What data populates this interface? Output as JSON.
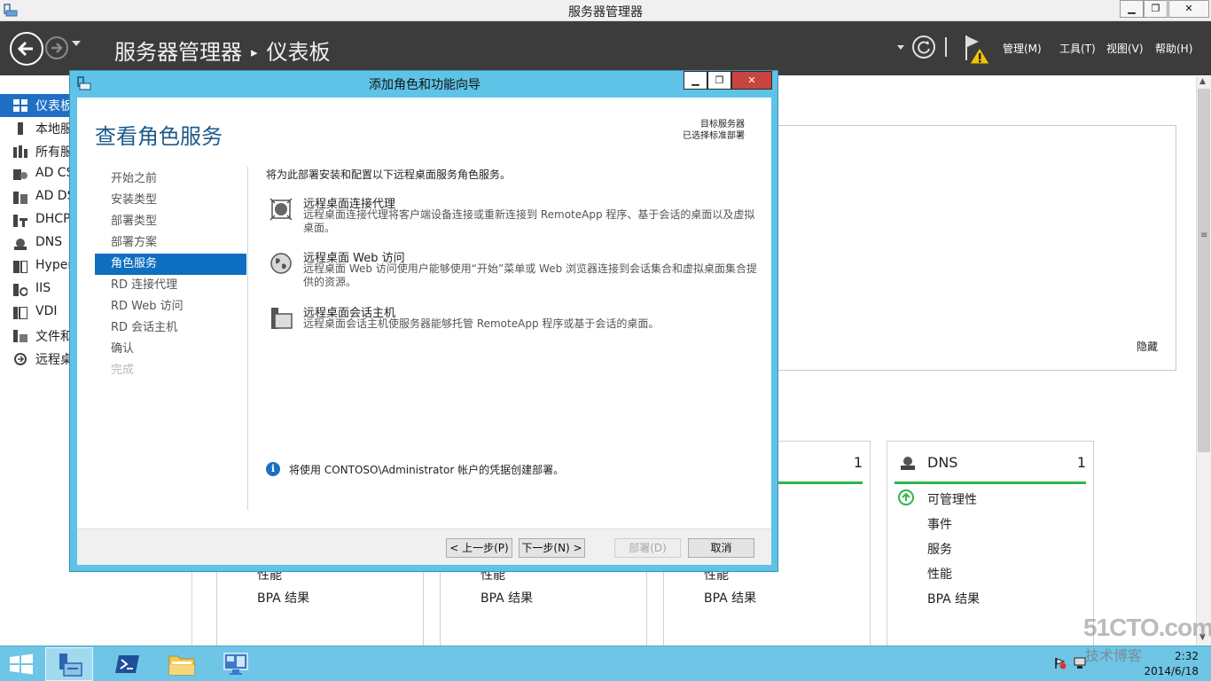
{
  "window": {
    "title": "服务器管理器",
    "min_label": "▁",
    "max_label": "❐",
    "close_label": "✕"
  },
  "header": {
    "breadcrumb_root": "服务器管理器",
    "breadcrumb_sep": "▸",
    "breadcrumb_page": "仪表板",
    "menus": [
      "管理(M)",
      "工具(T)",
      "视图(V)",
      "帮助(H)"
    ]
  },
  "leftnav": {
    "items": [
      {
        "label": "仪表板",
        "icon": "dashboard-icon"
      },
      {
        "label": "本地服",
        "icon": "local-server-icon"
      },
      {
        "label": "所有服",
        "icon": "all-servers-icon"
      },
      {
        "label": "AD CS",
        "icon": "ad-cs-icon"
      },
      {
        "label": "AD DS",
        "icon": "ad-ds-icon"
      },
      {
        "label": "DHCP",
        "icon": "dhcp-icon"
      },
      {
        "label": "DNS",
        "icon": "dns-icon"
      },
      {
        "label": "Hyper",
        "icon": "hyper-v-icon"
      },
      {
        "label": "IIS",
        "icon": "iis-icon"
      },
      {
        "label": "VDI",
        "icon": "vdi-icon"
      },
      {
        "label": "文件和",
        "icon": "file-services-icon"
      },
      {
        "label": "远程桌",
        "icon": "remote-desktop-icon"
      }
    ]
  },
  "background": {
    "hide_label": "隐藏",
    "tiles": [
      {
        "name": "",
        "count": "",
        "lines": [
          "性能",
          "BPA 结果"
        ]
      },
      {
        "name": "",
        "count": "",
        "lines": [
          "性能",
          "BPA 结果"
        ]
      },
      {
        "name": "",
        "count": "1",
        "lines": [
          "性能",
          "BPA 结果"
        ]
      },
      {
        "name": "DNS",
        "count": "1",
        "lines": [
          "可管理性",
          "事件",
          "服务",
          "性能",
          "BPA 结果"
        ]
      }
    ]
  },
  "wizard": {
    "title": "添加角色和功能向导",
    "heading": "查看角色服务",
    "target_label": "目标服务器",
    "target_value": "已选择标准部署",
    "steps": [
      {
        "label": "开始之前",
        "state": "normal"
      },
      {
        "label": "安装类型",
        "state": "normal"
      },
      {
        "label": "部署类型",
        "state": "normal"
      },
      {
        "label": "部署方案",
        "state": "normal"
      },
      {
        "label": "角色服务",
        "state": "active"
      },
      {
        "label": "RD 连接代理",
        "state": "normal"
      },
      {
        "label": "RD Web 访问",
        "state": "normal"
      },
      {
        "label": "RD 会话主机",
        "state": "normal"
      },
      {
        "label": "确认",
        "state": "normal"
      },
      {
        "label": "完成",
        "state": "disabled"
      }
    ],
    "intro": "将为此部署安装和配置以下远程桌面服务角色服务。",
    "services": [
      {
        "name": "远程桌面连接代理",
        "desc": "远程桌面连接代理将客户端设备连接或重新连接到 RemoteApp 程序、基于会话的桌面以及虚拟桌面。",
        "icon": "connection-broker-icon"
      },
      {
        "name": "远程桌面 Web 访问",
        "desc": "远程桌面 Web 访问使用户能够使用“开始”菜单或 Web 浏览器连接到会话集合和虚拟桌面集合提供的资源。",
        "icon": "web-access-globe-icon"
      },
      {
        "name": "远程桌面会话主机",
        "desc": "远程桌面会话主机使服务器能够托管 RemoteApp 程序或基于会话的桌面。",
        "icon": "session-host-icon"
      }
    ],
    "info": "将使用 CONTOSO\\Administrator 帐户的凭据创建部署。",
    "buttons": {
      "prev": "< 上一步(P)",
      "next": "下一步(N) >",
      "deploy": "部署(D)",
      "cancel": "取消"
    }
  },
  "taskbar": {
    "apps": [
      "server-manager-app",
      "powershell-app",
      "file-explorer-app",
      "rdp-app"
    ],
    "time": "2:32",
    "date": "2014/6/18"
  },
  "watermark": {
    "line1": "51CTO.com",
    "line2": "技术博客"
  }
}
